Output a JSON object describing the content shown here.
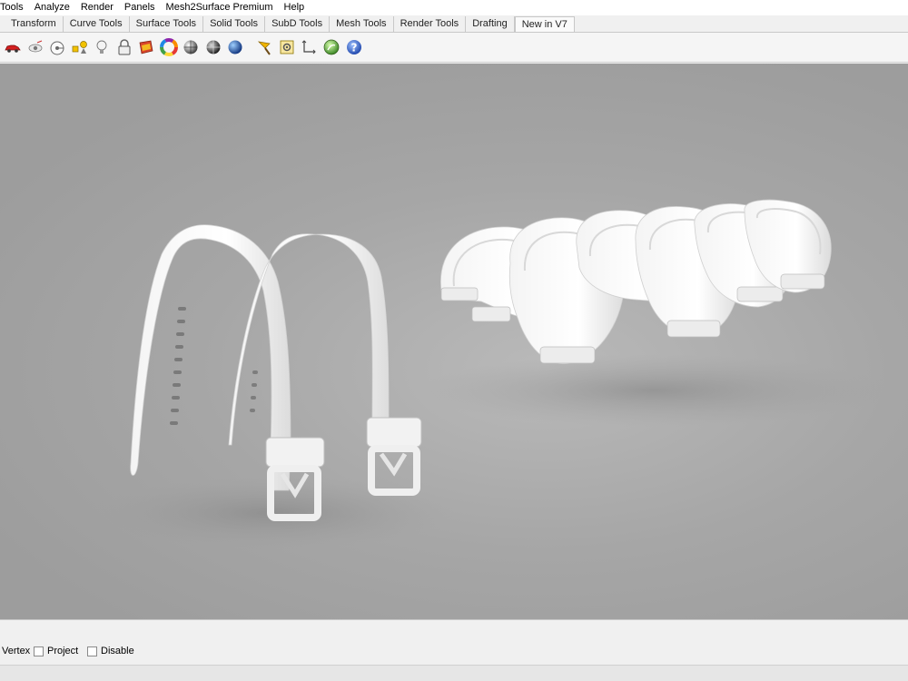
{
  "menubar": {
    "items": [
      "Tools",
      "Analyze",
      "Render",
      "Panels",
      "Mesh2Surface Premium",
      "Help"
    ]
  },
  "tabs": {
    "items": [
      "Transform",
      "Curve Tools",
      "Surface Tools",
      "Solid Tools",
      "SubD Tools",
      "Mesh Tools",
      "Render Tools",
      "Drafting",
      "New in V7"
    ]
  },
  "toolbar": {
    "icons": [
      "car-render-icon",
      "eye-view-icon",
      "circle-target-icon",
      "shapes-icon",
      "light-bulb-icon",
      "lock-icon",
      "materials-icon",
      "color-wheel-icon",
      "gray-sphere-icon",
      "dark-sphere-icon",
      "blue-sphere-icon",
      "brush-icon",
      "settings-grid-icon",
      "dimension-icon",
      "globe-icon",
      "help-icon"
    ]
  },
  "osnap": {
    "vertex_label": "Vertex",
    "project_label": "Project",
    "disable_label": "Disable"
  }
}
